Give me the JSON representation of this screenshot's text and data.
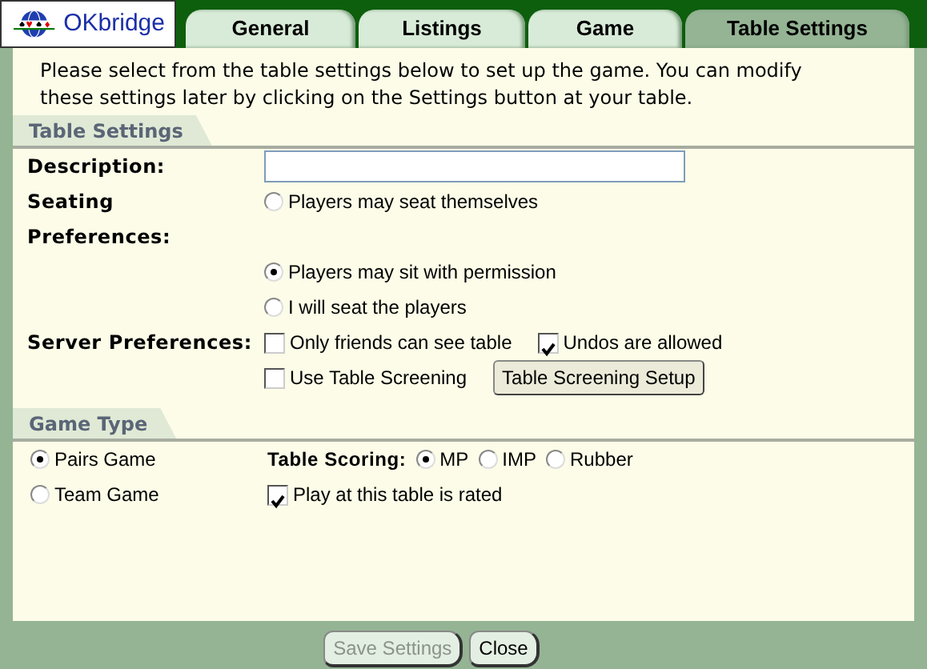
{
  "logo": {
    "text": "OKbridge"
  },
  "tabs": [
    {
      "label": "General",
      "selected": false
    },
    {
      "label": "Listings",
      "selected": false
    },
    {
      "label": "Game",
      "selected": false
    },
    {
      "label": "Table Settings",
      "selected": true
    }
  ],
  "intro": "Please select from the table settings below to set up the game.  You can modify these settings later by clicking on the Settings button at your table.",
  "table_settings": {
    "title": "Table Settings",
    "description": {
      "label": "Description:"
    },
    "seating": {
      "label": "Seating Preferences:",
      "options": [
        {
          "label": "Players may seat themselves",
          "selected": false
        },
        {
          "label": "Players may sit with permission",
          "selected": true
        },
        {
          "label": "I will seat the players",
          "selected": false
        }
      ]
    },
    "server": {
      "label": "Server Preferences:",
      "options": [
        {
          "label": "Only friends can see table",
          "checked": false
        },
        {
          "label": "Undos are allowed",
          "checked": true
        }
      ],
      "screening": {
        "label": "Use Table Screening",
        "checked": false
      },
      "setup_button": "Table Screening Setup"
    }
  },
  "game_type": {
    "title": "Game Type",
    "options": [
      {
        "label": "Pairs Game",
        "selected": true
      },
      {
        "label": "Team Game",
        "selected": false
      }
    ],
    "scoring": {
      "label": "Table Scoring:",
      "options": [
        {
          "label": "MP",
          "selected": true
        },
        {
          "label": "IMP",
          "selected": false
        },
        {
          "label": "Rubber",
          "selected": false
        }
      ]
    },
    "rated": {
      "label": "Play at this table is rated",
      "checked": true
    }
  },
  "buttons": [
    {
      "label": "Save Settings",
      "disabled": true
    },
    {
      "label": "Close",
      "disabled": false
    }
  ]
}
